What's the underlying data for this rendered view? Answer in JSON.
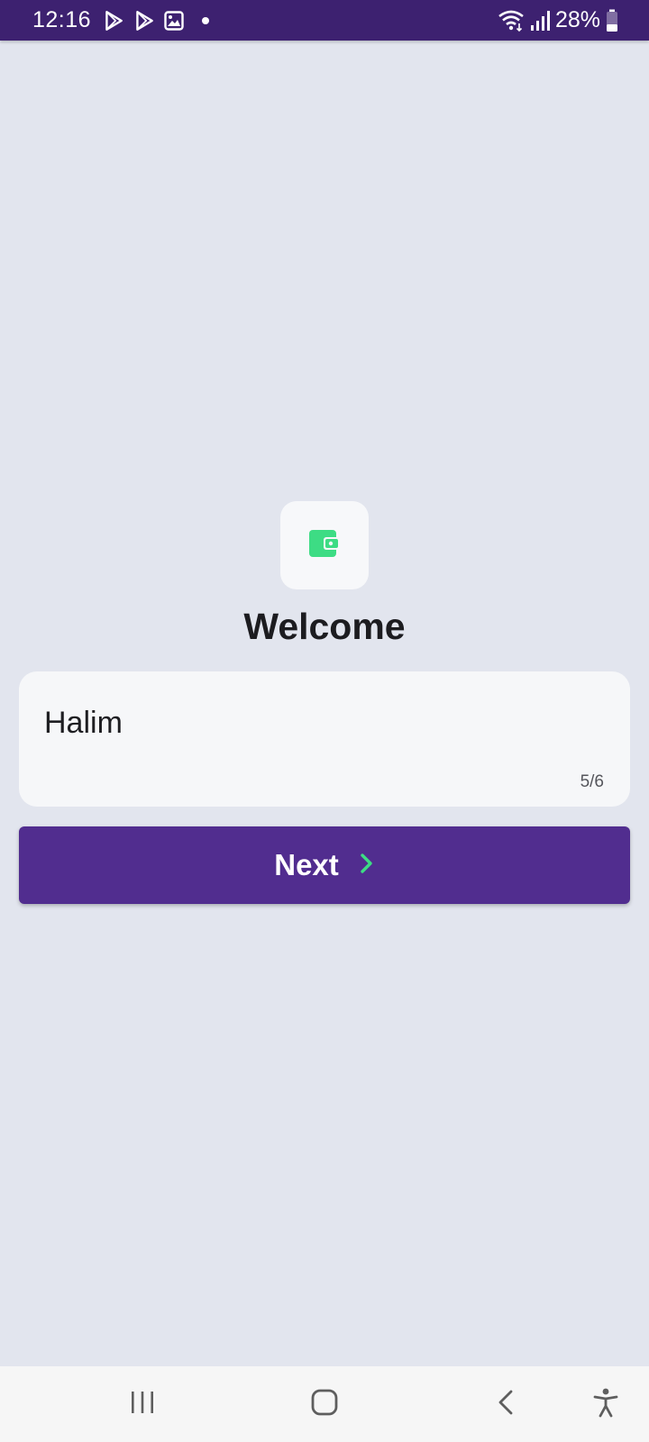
{
  "status_bar": {
    "time": "12:16",
    "battery": "28%",
    "notification_icons": [
      "play-store-icon",
      "play-store-icon",
      "gallery-icon",
      "dot-icon"
    ]
  },
  "welcome": {
    "app_icon": "wallet-icon",
    "title": "Welcome"
  },
  "name_field": {
    "value": "Halim",
    "counter": "5/6"
  },
  "next_button": {
    "label": "Next",
    "icon": "chevron-right-icon"
  },
  "colors": {
    "status_bar": "#3d2170",
    "background": "#e2e5ee",
    "primary": "#512d8f",
    "accent": "#3ddc84"
  },
  "nav_bar": {
    "buttons": [
      "recents-icon",
      "home-icon",
      "back-icon",
      "accessibility-icon"
    ]
  }
}
